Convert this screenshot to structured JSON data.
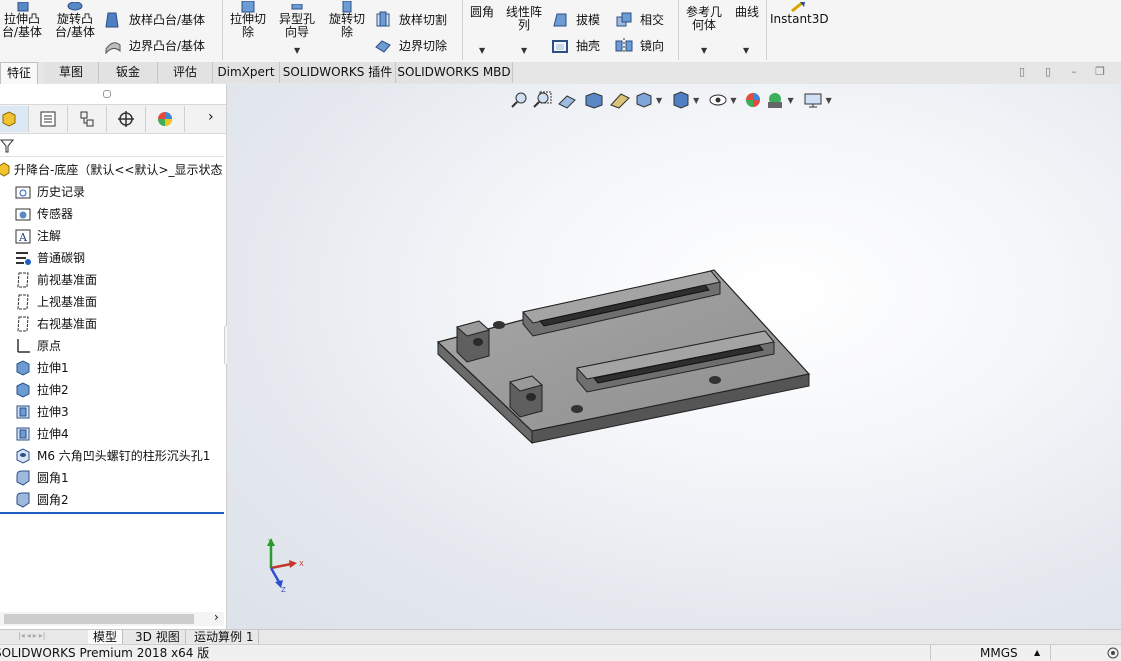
{
  "ribbon": {
    "extrude_boss": "拉伸凸\n台/基体",
    "revolve_boss": "旋转凸\n台/基体",
    "loft_boss": "放样凸台/基体",
    "boundary_boss": "边界凸台/基体",
    "extrude_cut": "拉伸切\n除",
    "hole_wizard": "异型孔\n向导",
    "revolve_cut": "旋转切\n除",
    "loft_cut": "放样切割",
    "boundary_cut": "边界切除",
    "fillet": "圆角",
    "linear_pattern": "线性阵\n列",
    "draft": "拔模",
    "intersect": "相交",
    "shell": "抽壳",
    "mirror": "镜向",
    "ref_geometry": "参考几\n何体",
    "curves": "曲线",
    "instant3d": "Instant3D"
  },
  "tabs": [
    {
      "label": "特征",
      "active": true
    },
    {
      "label": "草图"
    },
    {
      "label": "钣金"
    },
    {
      "label": "评估"
    },
    {
      "label": "DimXpert"
    },
    {
      "label": "SOLIDWORKS 插件"
    },
    {
      "label": "SOLIDWORKS MBD"
    }
  ],
  "tree": {
    "root": "升降台-底座（默认<<默认>_显示状态",
    "items": [
      {
        "label": "历史记录",
        "icon": "history-icon"
      },
      {
        "label": "传感器",
        "icon": "sensor-icon"
      },
      {
        "label": "注解",
        "icon": "annotation-icon"
      },
      {
        "label": "普通碳钢",
        "icon": "material-icon"
      },
      {
        "label": "前视基准面",
        "icon": "plane-icon"
      },
      {
        "label": "上视基准面",
        "icon": "plane-icon"
      },
      {
        "label": "右视基准面",
        "icon": "plane-icon"
      },
      {
        "label": "原点",
        "icon": "origin-icon"
      },
      {
        "label": "拉伸1",
        "icon": "extrude-icon"
      },
      {
        "label": "拉伸2",
        "icon": "extrude-icon"
      },
      {
        "label": "拉伸3",
        "icon": "cut-icon"
      },
      {
        "label": "拉伸4",
        "icon": "cut-icon"
      },
      {
        "label": "M6 六角凹头螺钉的柱形沉头孔1",
        "icon": "hole-icon"
      },
      {
        "label": "圆角1",
        "icon": "fillet-icon"
      },
      {
        "label": "圆角2",
        "icon": "fillet-icon"
      }
    ]
  },
  "triad": {
    "x": "X",
    "y": "Y",
    "z": "Z"
  },
  "bottom_tabs": [
    {
      "label": "模型",
      "active": true
    },
    {
      "label": "3D 视图"
    },
    {
      "label": "运动算例 1"
    }
  ],
  "status": {
    "product": "SOLIDWORKS Premium 2018 x64 版",
    "units": "MMGS"
  },
  "colors": {
    "accent": "#1f5fbf",
    "part_face": "#8a8a8a",
    "part_top": "#9c9c9c",
    "part_edge": "#2a2a2a"
  }
}
